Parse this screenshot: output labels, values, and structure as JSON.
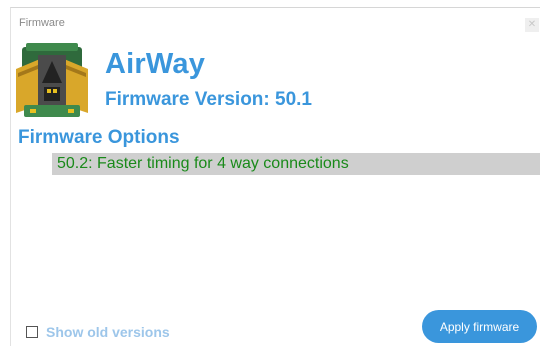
{
  "window": {
    "title": "Firmware"
  },
  "app": {
    "name": "AirWay",
    "firmware_version": "Firmware Version: 50.1",
    "icon": "airway-device-icon"
  },
  "options": {
    "heading": "Firmware Options",
    "items": [
      {
        "label": "50.2: Faster timing for 4 way connections"
      }
    ]
  },
  "footer": {
    "show_old_label": "Show old versions",
    "show_old_checked": false,
    "apply_label": "Apply firmware"
  },
  "colors": {
    "accent": "#3a96dc",
    "option_text": "#1a8a1a",
    "selection_bg": "#cfcfcf",
    "muted_link": "#9dc6ea"
  }
}
